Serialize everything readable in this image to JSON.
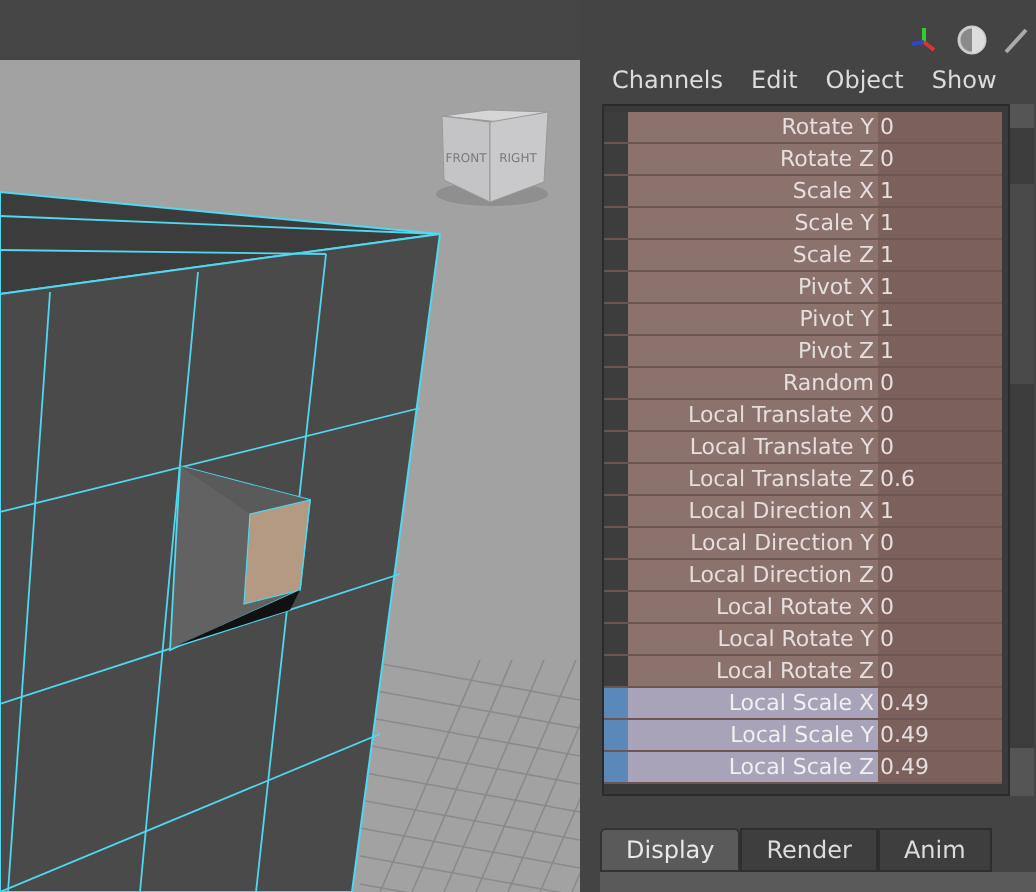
{
  "viewport": {
    "view_cube": {
      "faces": [
        "FRONT",
        "RIGHT"
      ]
    }
  },
  "channel_box": {
    "menu": [
      "Channels",
      "Edit",
      "Object",
      "Show"
    ],
    "channels": [
      {
        "name": "Rotate Y",
        "value": "0",
        "selected": false
      },
      {
        "name": "Rotate Z",
        "value": "0",
        "selected": false
      },
      {
        "name": "Scale X",
        "value": "1",
        "selected": false
      },
      {
        "name": "Scale Y",
        "value": "1",
        "selected": false
      },
      {
        "name": "Scale Z",
        "value": "1",
        "selected": false
      },
      {
        "name": "Pivot X",
        "value": "1",
        "selected": false
      },
      {
        "name": "Pivot Y",
        "value": "1",
        "selected": false
      },
      {
        "name": "Pivot Z",
        "value": "1",
        "selected": false
      },
      {
        "name": "Random",
        "value": "0",
        "selected": false
      },
      {
        "name": "Local Translate X",
        "value": "0",
        "selected": false
      },
      {
        "name": "Local Translate Y",
        "value": "0",
        "selected": false
      },
      {
        "name": "Local Translate Z",
        "value": "0.6",
        "selected": false
      },
      {
        "name": "Local Direction X",
        "value": "1",
        "selected": false
      },
      {
        "name": "Local Direction Y",
        "value": "0",
        "selected": false
      },
      {
        "name": "Local Direction Z",
        "value": "0",
        "selected": false
      },
      {
        "name": "Local Rotate X",
        "value": "0",
        "selected": false
      },
      {
        "name": "Local Rotate Y",
        "value": "0",
        "selected": false
      },
      {
        "name": "Local Rotate Z",
        "value": "0",
        "selected": false
      },
      {
        "name": "Local Scale X",
        "value": "0.49",
        "selected": true
      },
      {
        "name": "Local Scale Y",
        "value": "0.49",
        "selected": true
      },
      {
        "name": "Local Scale Z",
        "value": "0.49",
        "selected": true
      }
    ],
    "tabs": [
      {
        "label": "Display",
        "selected": true
      },
      {
        "label": "Render",
        "selected": false
      },
      {
        "label": "Anim",
        "selected": false
      }
    ]
  }
}
